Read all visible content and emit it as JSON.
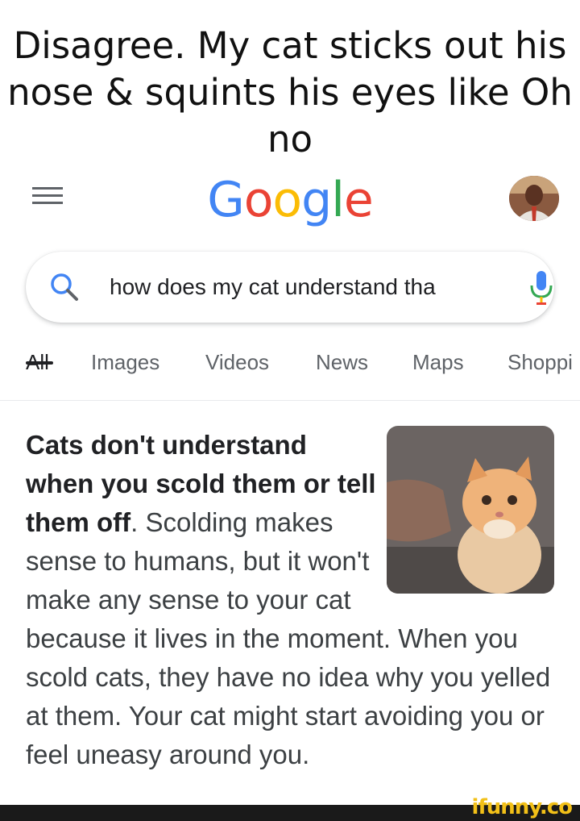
{
  "caption": "Disagree. My cat sticks out his nose & squints his eyes like Oh no",
  "header": {
    "logo_letters": [
      "G",
      "o",
      "o",
      "g",
      "l",
      "e"
    ],
    "logo_colors": [
      "#4285F4",
      "#EA4335",
      "#FBBC05",
      "#4285F4",
      "#34A853",
      "#EA4335"
    ]
  },
  "search": {
    "query": "how does my cat understand tha"
  },
  "tabs": [
    {
      "label": "All",
      "active": true
    },
    {
      "label": "Images",
      "active": false
    },
    {
      "label": "Videos",
      "active": false
    },
    {
      "label": "News",
      "active": false
    },
    {
      "label": "Maps",
      "active": false
    },
    {
      "label": "Shoppi",
      "active": false
    }
  ],
  "result": {
    "bold_text": "Cats don't understand when you scold them or tell them off",
    "body_text": ". Scolding makes sense to humans, but it won't make any sense to your cat because it lives in the moment. When you scold cats, they have no idea why you yelled at them. Your cat might start avoiding you or feel uneasy around you."
  },
  "watermark": "ifunny.co",
  "colors": {
    "text": "#202124",
    "secondary": "#5f6368",
    "watermark": "#f2c018"
  }
}
